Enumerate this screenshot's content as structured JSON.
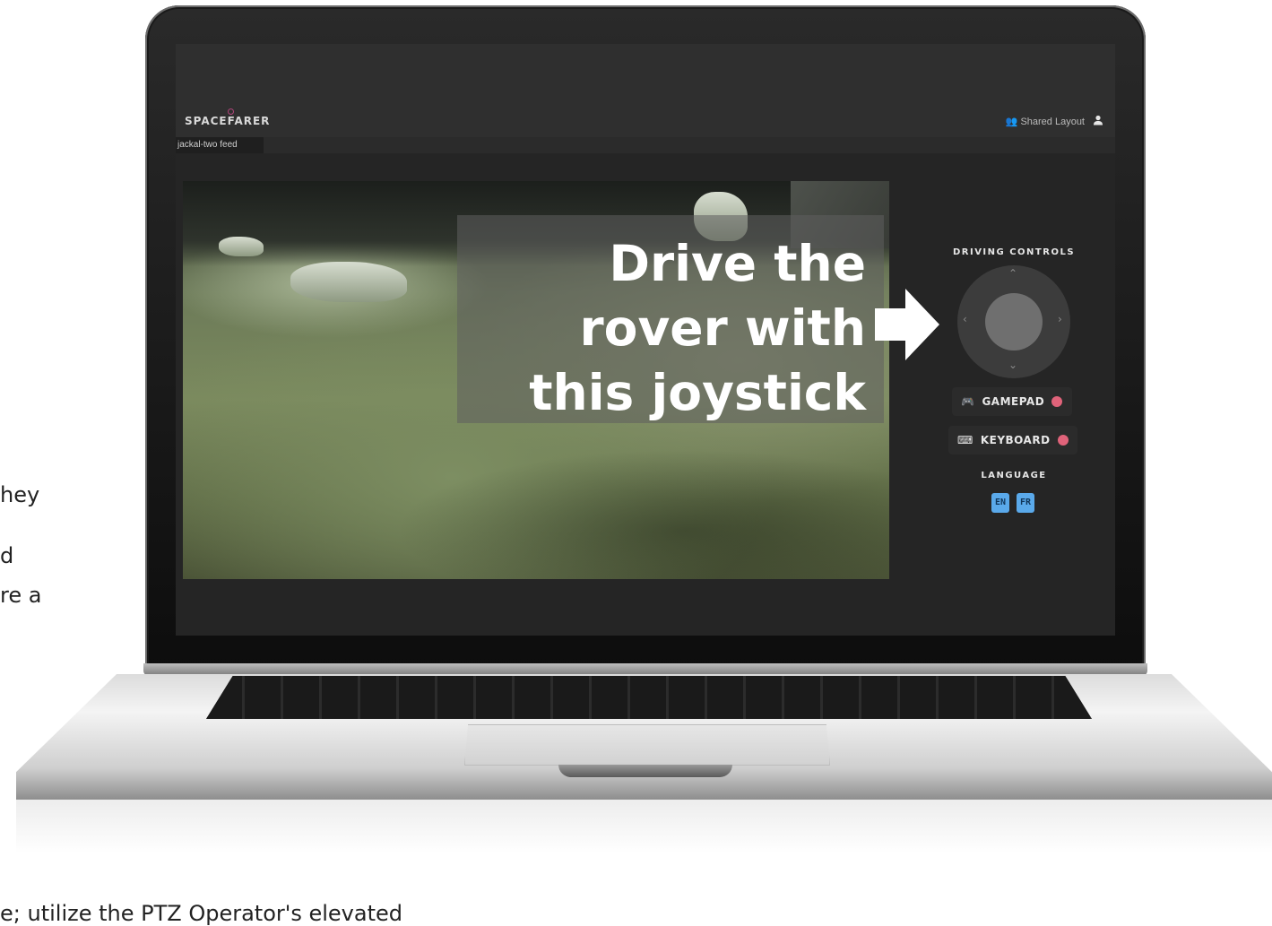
{
  "background": {
    "fragments": [
      "hey",
      "d",
      "re a",
      "e; utilize the PTZ Operator's elevated"
    ]
  },
  "app": {
    "logo": "SPACEFARER",
    "shared_layout_label": "Shared Layout",
    "tab_label": "jackal-two feed"
  },
  "overlay": {
    "callout_text": "Drive the\nrover with\nthis joystick"
  },
  "driving_controls": {
    "title": "DRIVING CONTROLS",
    "gamepad_label": "GAMEPAD",
    "keyboard_label": "KEYBOARD",
    "gamepad_status_color": "#e0637a",
    "keyboard_status_color": "#e0637a"
  },
  "language": {
    "title": "LANGUAGE",
    "options": [
      "EN",
      "FR"
    ]
  },
  "icons": [
    "user-group-icon",
    "user-icon",
    "gamepad-icon",
    "keyboard-icon",
    "arrow-right-icon",
    "chevron-up-icon",
    "chevron-down-icon",
    "chevron-left-icon",
    "chevron-right-icon"
  ],
  "colors": {
    "accent_blue": "#5aa9ea",
    "status_red": "#e0637a",
    "logo_accent": "#b0447a"
  }
}
